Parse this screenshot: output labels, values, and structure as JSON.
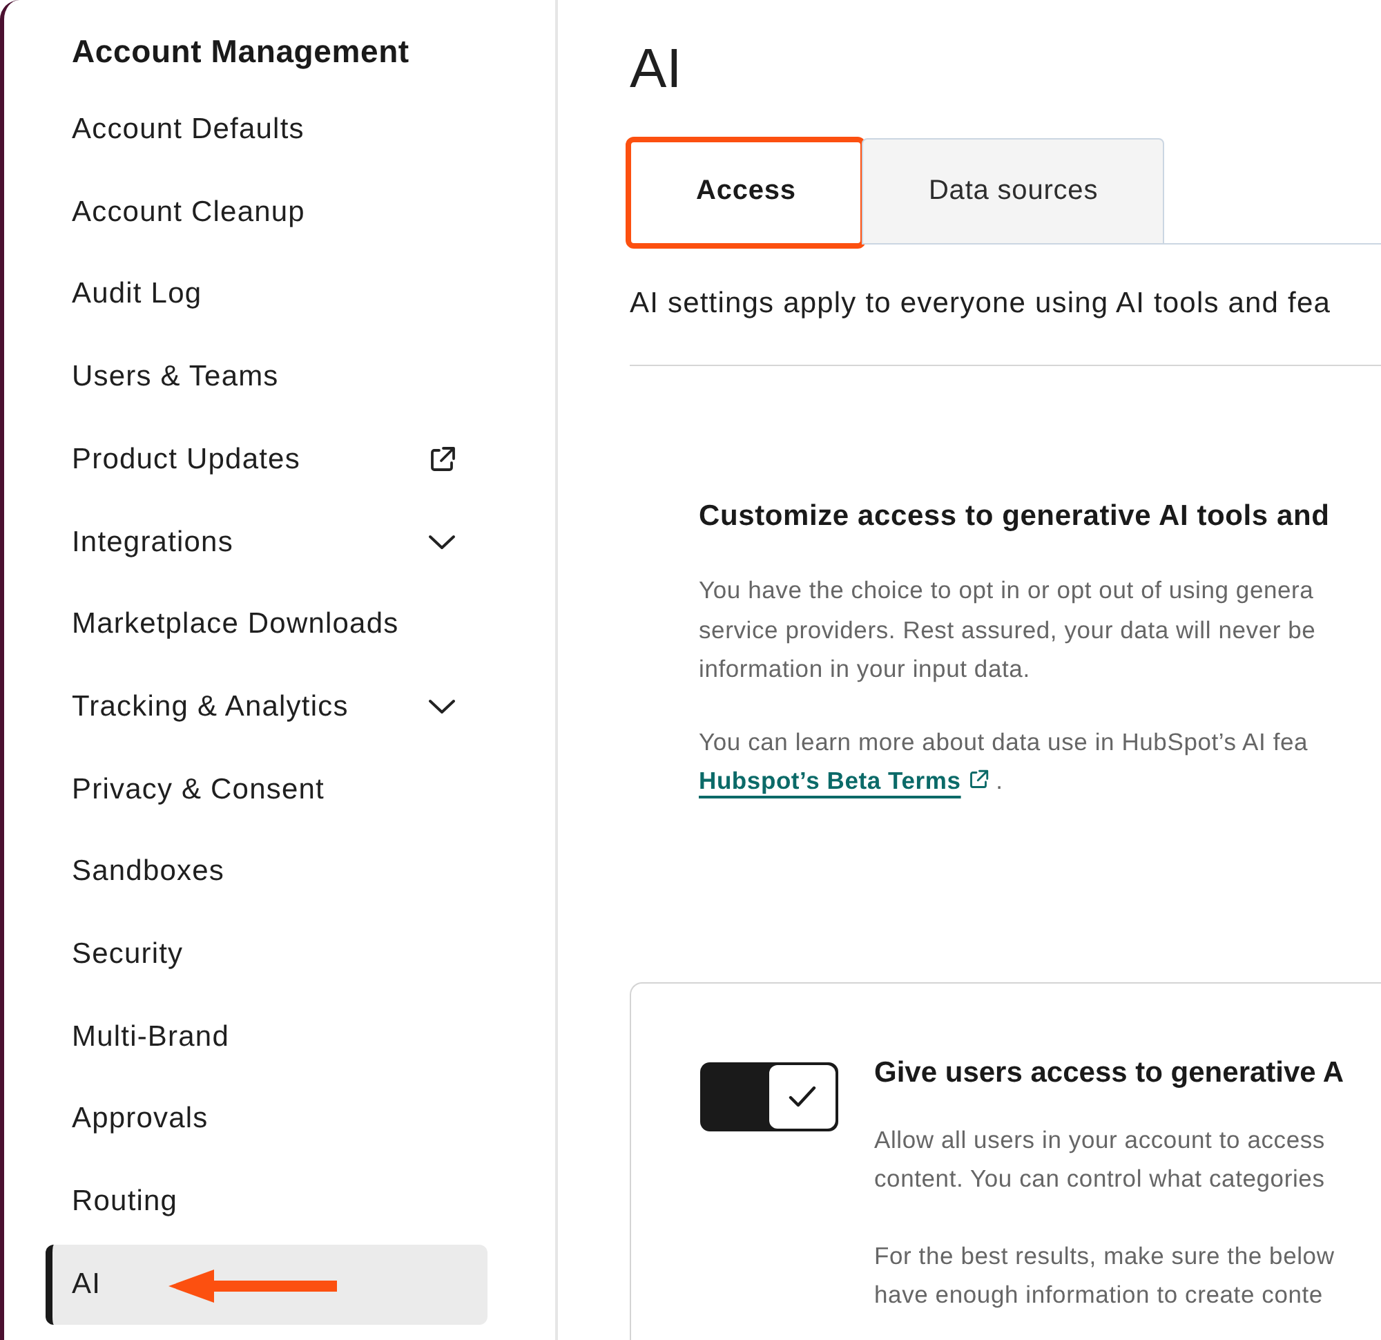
{
  "sidebar": {
    "heading": "Account Management",
    "items": [
      {
        "label": "Account Defaults",
        "kind": "link",
        "selected": false,
        "pointer_arrow": false
      },
      {
        "label": "Account Cleanup",
        "kind": "link",
        "selected": false,
        "pointer_arrow": false
      },
      {
        "label": "Audit Log",
        "kind": "link",
        "selected": false,
        "pointer_arrow": false
      },
      {
        "label": "Users & Teams",
        "kind": "link",
        "selected": false,
        "pointer_arrow": false
      },
      {
        "label": "Product Updates",
        "kind": "external",
        "selected": false,
        "pointer_arrow": false
      },
      {
        "label": "Integrations",
        "kind": "expandable",
        "selected": false,
        "pointer_arrow": false
      },
      {
        "label": "Marketplace Downloads",
        "kind": "link",
        "selected": false,
        "pointer_arrow": false
      },
      {
        "label": "Tracking & Analytics",
        "kind": "expandable",
        "selected": false,
        "pointer_arrow": false
      },
      {
        "label": "Privacy & Consent",
        "kind": "link",
        "selected": false,
        "pointer_arrow": false
      },
      {
        "label": "Sandboxes",
        "kind": "link",
        "selected": false,
        "pointer_arrow": false
      },
      {
        "label": "Security",
        "kind": "link",
        "selected": false,
        "pointer_arrow": false
      },
      {
        "label": "Multi-Brand",
        "kind": "link",
        "selected": false,
        "pointer_arrow": false
      },
      {
        "label": "Approvals",
        "kind": "link",
        "selected": false,
        "pointer_arrow": false
      },
      {
        "label": "Routing",
        "kind": "link",
        "selected": false,
        "pointer_arrow": false
      },
      {
        "label": "AI",
        "kind": "link",
        "selected": true,
        "pointer_arrow": true
      }
    ]
  },
  "main": {
    "title": "AI",
    "tabs": [
      {
        "label": "Access",
        "selected": true,
        "highlight_box": true
      },
      {
        "label": "Data sources",
        "selected": false,
        "highlight_box": false
      }
    ],
    "intro": "AI settings apply to everyone using AI tools and fea",
    "section": {
      "heading": "Customize access to generative AI tools and",
      "paragraphs": [
        {
          "lines": [
            "You have the choice to opt in or opt out of using genera",
            "service providers. Rest assured, your data will never be",
            "information in your input data."
          ]
        },
        {
          "lines": [
            "You can learn more about data use in HubSpot’s AI fea"
          ],
          "link": "Hubspot’s Beta Terms",
          "after_link": "."
        }
      ]
    },
    "card": {
      "toggle_on": true,
      "heading": "Give users access to generative A",
      "paragraphs": [
        {
          "lines": [
            "Allow all users in your account to access",
            "content. You can control what categories"
          ]
        },
        {
          "lines": [
            "For the best results, make sure the below",
            "have enough information to create conte"
          ]
        }
      ]
    }
  }
}
